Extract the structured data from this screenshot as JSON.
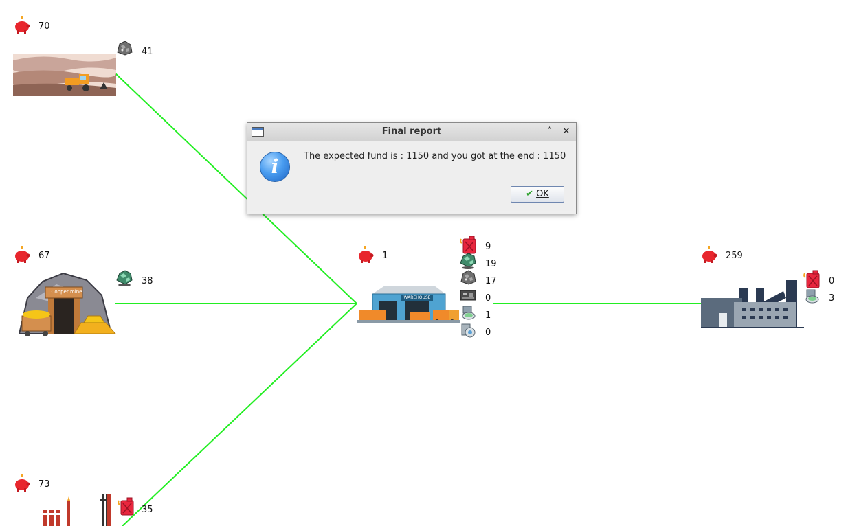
{
  "nodes": {
    "quarry": {
      "funds": "70",
      "resource_count": "41",
      "resource_icon": "stone-ore-icon"
    },
    "copper_mine": {
      "funds": "67",
      "resource_count": "38",
      "resource_icon": "copper-ore-icon",
      "sign": "Copper mine"
    },
    "oil_refinery": {
      "funds": "73",
      "resource_count": "35",
      "resource_icon": "fuel-can-icon"
    },
    "warehouse": {
      "funds": "1",
      "sign": "WAREHOUSE",
      "stock": [
        {
          "icon": "fuel-can-icon",
          "count": "9"
        },
        {
          "icon": "copper-ore-icon",
          "count": "19"
        },
        {
          "icon": "stone-ore-icon",
          "count": "17"
        },
        {
          "icon": "circuit-board-icon",
          "count": "0"
        },
        {
          "icon": "paint-bucket-icon",
          "count": "1"
        },
        {
          "icon": "machine-part-icon",
          "count": "0"
        }
      ]
    },
    "factory": {
      "funds": "259",
      "stock": [
        {
          "icon": "fuel-can-icon",
          "count": "0"
        },
        {
          "icon": "paint-bucket-icon",
          "count": "3"
        }
      ]
    }
  },
  "colors": {
    "link": "#22ee22",
    "funds_icon": "#e8262d",
    "dialog_bg": "#eeeeee"
  },
  "dialog": {
    "title": "Final report",
    "message": "The expected fund is : 1150 and you got at the end : 1150",
    "ok_label": "OK",
    "icon": "info-icon"
  }
}
